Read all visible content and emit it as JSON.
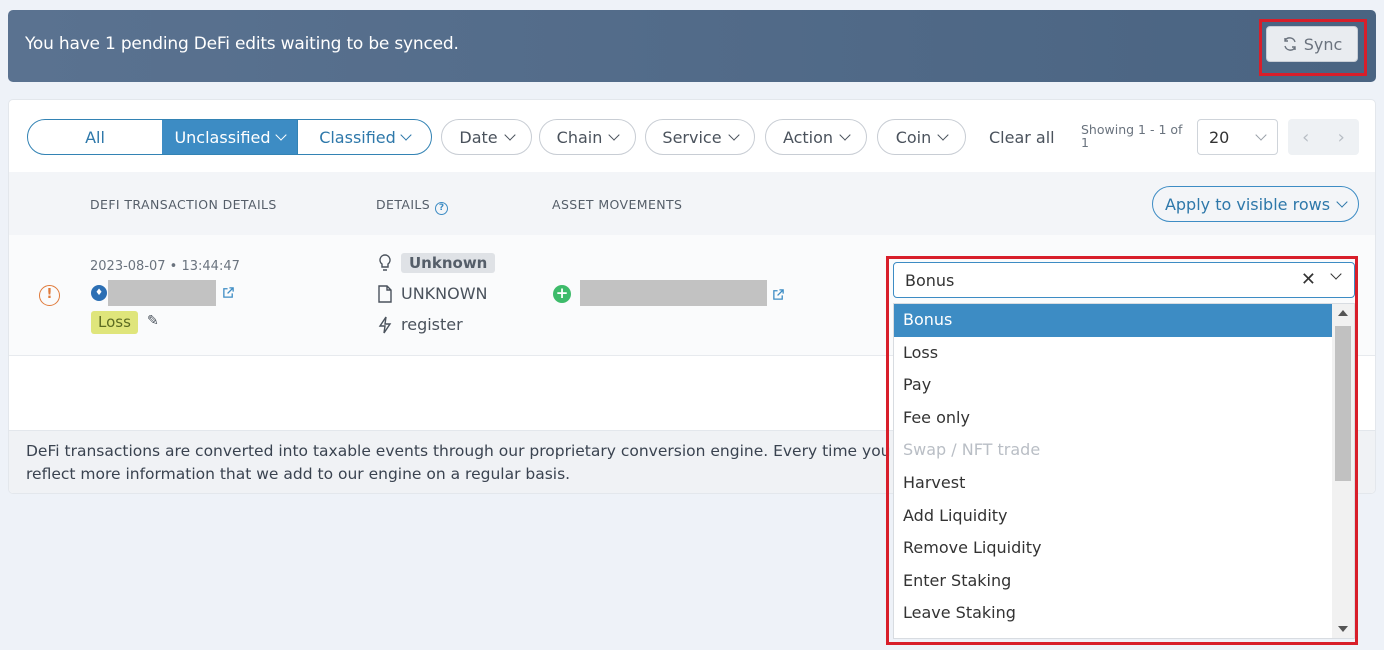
{
  "banner": {
    "message": "You have 1 pending DeFi edits waiting to be synced.",
    "sync_label": "Sync"
  },
  "filters": {
    "segments": [
      "All",
      "Unclassified",
      "Classified"
    ],
    "pills": [
      "Date",
      "Chain",
      "Service",
      "Action",
      "Coin"
    ],
    "clear_all": "Clear all",
    "showing": "Showing 1 - 1 of 1",
    "per_page": "20"
  },
  "table": {
    "headers": [
      "DEFI TRANSACTION DETAILS",
      "DETAILS",
      "ASSET MOVEMENTS"
    ],
    "apply_label": "Apply to visible rows",
    "row": {
      "datetime": "2023-08-07 • 13:44:47",
      "tag": "Loss",
      "detail_badge": "Unknown",
      "detail_type": "UNKNOWN",
      "detail_method": "register"
    }
  },
  "footer": {
    "line1": "DeFi transactions are converted into taxable events through our proprietary conversion engine. Every time you reproce",
    "line2": "reflect more information that we add to our engine on a regular basis."
  },
  "dropdown": {
    "value": "Bonus",
    "options": [
      {
        "label": "Bonus",
        "selected": true,
        "disabled": false
      },
      {
        "label": "Loss",
        "selected": false,
        "disabled": false
      },
      {
        "label": "Pay",
        "selected": false,
        "disabled": false
      },
      {
        "label": "Fee only",
        "selected": false,
        "disabled": false
      },
      {
        "label": "Swap / NFT trade",
        "selected": false,
        "disabled": true
      },
      {
        "label": "Harvest",
        "selected": false,
        "disabled": false
      },
      {
        "label": "Add Liquidity",
        "selected": false,
        "disabled": false
      },
      {
        "label": "Remove Liquidity",
        "selected": false,
        "disabled": false
      },
      {
        "label": "Enter Staking",
        "selected": false,
        "disabled": false
      },
      {
        "label": "Leave Staking",
        "selected": false,
        "disabled": false
      }
    ]
  }
}
